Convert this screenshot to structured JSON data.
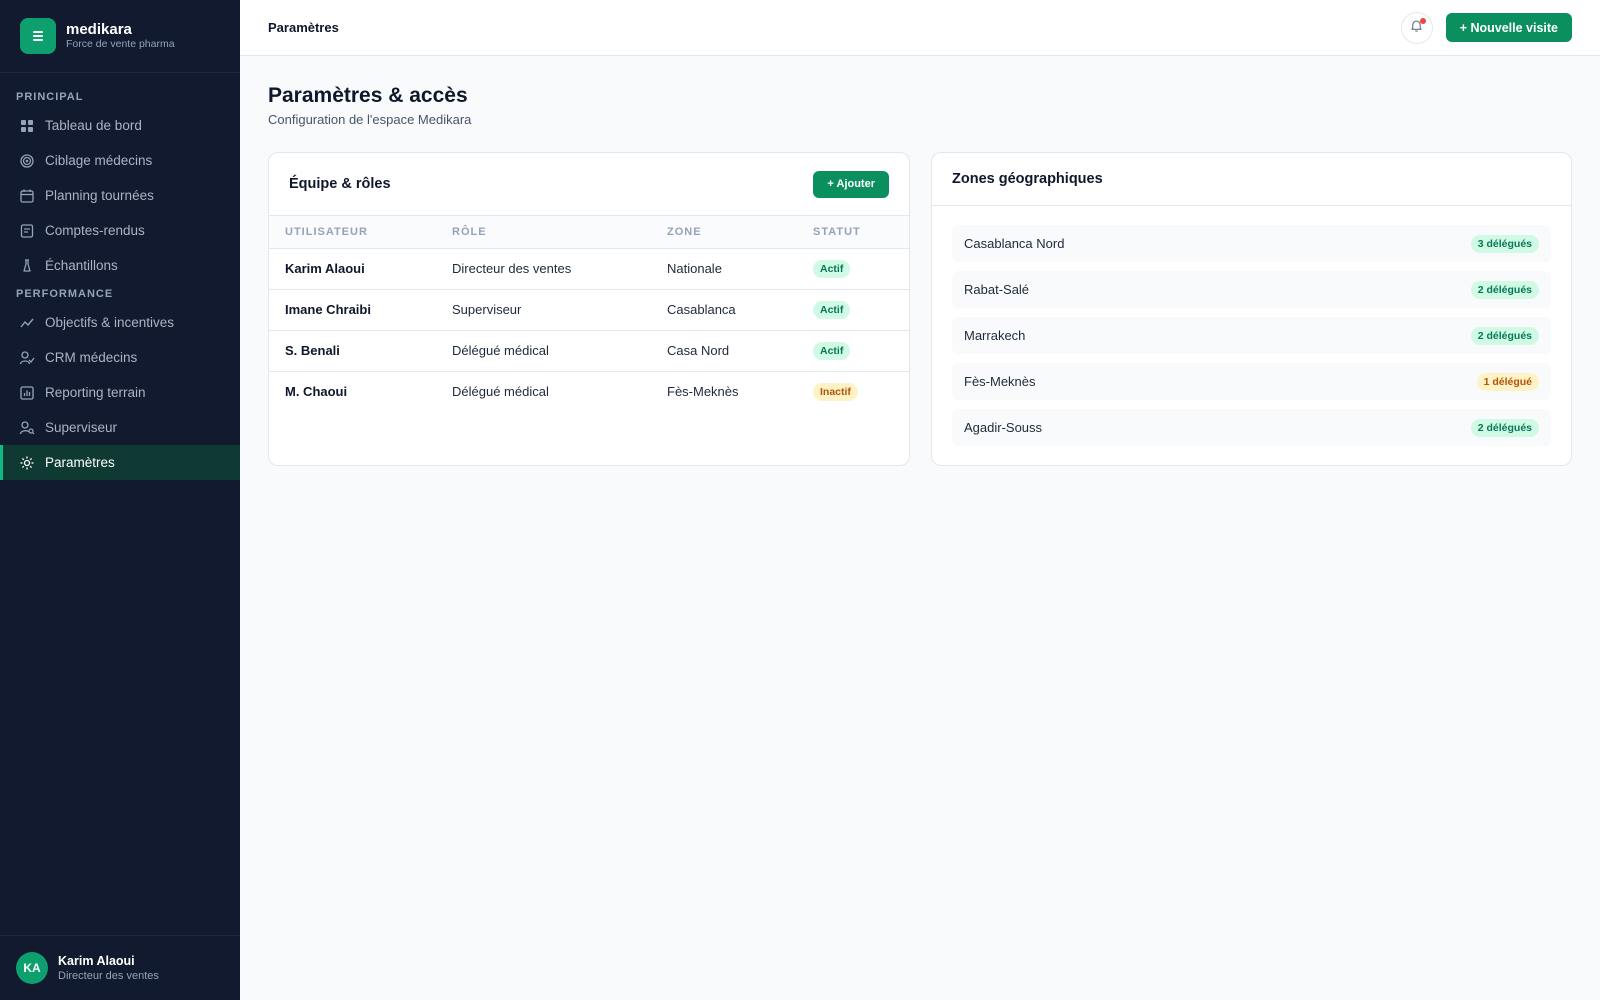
{
  "brand": {
    "name": "medikara",
    "tagline": "Force de vente pharma"
  },
  "sidebar": {
    "sections": [
      {
        "label": "PRINCIPAL",
        "items": [
          {
            "label": "Tableau de bord",
            "icon": "grid-icon"
          },
          {
            "label": "Ciblage médecins",
            "icon": "target-icon"
          },
          {
            "label": "Planning tournées",
            "icon": "calendar-icon"
          },
          {
            "label": "Comptes-rendus",
            "icon": "document-icon"
          },
          {
            "label": "Échantillons",
            "icon": "flask-icon"
          }
        ]
      },
      {
        "label": "PERFORMANCE",
        "items": [
          {
            "label": "Objectifs & incentives",
            "icon": "trend-icon"
          },
          {
            "label": "CRM médecins",
            "icon": "user-check-icon"
          },
          {
            "label": "Reporting terrain",
            "icon": "chart-icon"
          },
          {
            "label": "Superviseur",
            "icon": "user-search-icon"
          },
          {
            "label": "Paramètres",
            "icon": "gear-icon",
            "active": true
          }
        ]
      }
    ],
    "user": {
      "initials": "KA",
      "name": "Karim Alaoui",
      "role": "Directeur des ventes"
    }
  },
  "topbar": {
    "title": "Paramètres",
    "new_visit_label": "+ Nouvelle visite"
  },
  "page": {
    "title": "Paramètres & accès",
    "subtitle": "Configuration de l'espace Medikara"
  },
  "team": {
    "title": "Équipe & rôles",
    "add_label": "+ Ajouter",
    "columns": [
      "UTILISATEUR",
      "RÔLE",
      "ZONE",
      "STATUT"
    ],
    "rows": [
      {
        "user": "Karim Alaoui",
        "role": "Directeur des ventes",
        "zone": "Nationale",
        "status": "Actif"
      },
      {
        "user": "Imane Chraibi",
        "role": "Superviseur",
        "zone": "Casablanca",
        "status": "Actif"
      },
      {
        "user": "S. Benali",
        "role": "Délégué médical",
        "zone": "Casa Nord",
        "status": "Actif"
      },
      {
        "user": "M. Chaoui",
        "role": "Délégué médical",
        "zone": "Fès-Meknès",
        "status": "Inactif"
      }
    ]
  },
  "zones": {
    "title": "Zones géographiques",
    "items": [
      {
        "name": "Casablanca Nord",
        "count": "3 délégués"
      },
      {
        "name": "Rabat-Salé",
        "count": "2 délégués"
      },
      {
        "name": "Marrakech",
        "count": "2 délégués"
      },
      {
        "name": "Fès-Meknès",
        "count": "1 délégué"
      },
      {
        "name": "Agadir-Souss",
        "count": "2 délégués"
      }
    ]
  },
  "colors": {
    "accent": "#0b8f5e",
    "sidebar_bg": "#111a2e",
    "active_green": "#d1fae5",
    "inactive_amber": "#fef3c7"
  }
}
